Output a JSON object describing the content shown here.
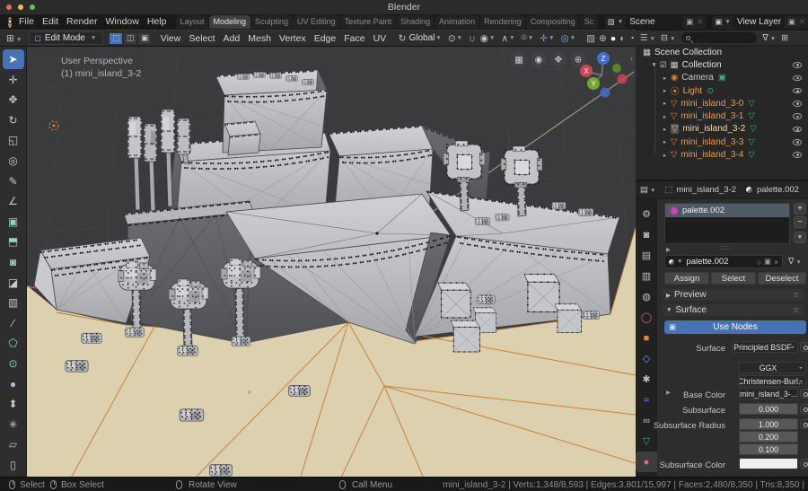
{
  "window": {
    "title": "Blender"
  },
  "menubar": {
    "menus": [
      {
        "name": "menu-file",
        "label": "File"
      },
      {
        "name": "menu-edit",
        "label": "Edit"
      },
      {
        "name": "menu-render",
        "label": "Render"
      },
      {
        "name": "menu-window",
        "label": "Window"
      },
      {
        "name": "menu-help",
        "label": "Help"
      }
    ],
    "workspaces": [
      {
        "name": "workspace-layout",
        "label": "Layout",
        "active": false
      },
      {
        "name": "workspace-modeling",
        "label": "Modeling",
        "active": true
      },
      {
        "name": "workspace-sculpting",
        "label": "Sculpting",
        "active": false
      },
      {
        "name": "workspace-uv-editing",
        "label": "UV Editing",
        "active": false
      },
      {
        "name": "workspace-texture-paint",
        "label": "Texture Paint",
        "active": false
      },
      {
        "name": "workspace-shading",
        "label": "Shading",
        "active": false
      },
      {
        "name": "workspace-animation",
        "label": "Animation",
        "active": false
      },
      {
        "name": "workspace-rendering",
        "label": "Rendering",
        "active": false
      },
      {
        "name": "workspace-compositing",
        "label": "Compositing",
        "active": false
      },
      {
        "name": "workspace-scripting",
        "label": "Sc",
        "active": false
      }
    ],
    "scene_selector": {
      "label": "Scene"
    },
    "view_layer_selector": {
      "label": "View Layer"
    }
  },
  "tool_header": {
    "mode": "Edit Mode",
    "menus": [
      {
        "name": "viewport-menu-view",
        "label": "View"
      },
      {
        "name": "viewport-menu-select",
        "label": "Select"
      },
      {
        "name": "viewport-menu-add",
        "label": "Add"
      },
      {
        "name": "viewport-menu-mesh",
        "label": "Mesh"
      },
      {
        "name": "viewport-menu-vertex",
        "label": "Vertex"
      },
      {
        "name": "viewport-menu-edge",
        "label": "Edge"
      },
      {
        "name": "viewport-menu-face",
        "label": "Face"
      },
      {
        "name": "viewport-menu-uv",
        "label": "UV"
      }
    ],
    "orientation": "Global"
  },
  "toolbar": {
    "tools": [
      {
        "name": "tweak-select-tool",
        "glyph": "➤",
        "color": "#ffffff",
        "active": true
      },
      {
        "name": "cursor-tool",
        "glyph": "✛",
        "color": "#c8c8c8",
        "active": false
      },
      {
        "name": "move-tool",
        "glyph": "✥",
        "color": "#c8c8c8",
        "active": false
      },
      {
        "name": "rotate-tool",
        "glyph": "↻",
        "color": "#c8c8c8",
        "active": false
      },
      {
        "name": "scale-tool",
        "glyph": "◱",
        "color": "#c8c8c8",
        "active": false
      },
      {
        "name": "transform-tool",
        "glyph": "◎",
        "color": "#c8c8c8",
        "active": false
      },
      {
        "name": "annotate-tool",
        "glyph": "✎",
        "color": "#c8c8c8",
        "active": false
      },
      {
        "name": "measure-tool",
        "glyph": "∠",
        "color": "#c8c8c8",
        "active": false
      },
      {
        "name": "add-cube-tool",
        "glyph": "▣",
        "color": "#8fd9b0",
        "active": false
      },
      {
        "name": "extrude-region-tool",
        "glyph": "⬒",
        "color": "#8fd9b0",
        "active": false
      },
      {
        "name": "inset-faces-tool",
        "glyph": "◙",
        "color": "#8fd9b0",
        "active": false
      },
      {
        "name": "bevel-tool",
        "glyph": "◪",
        "color": "#c8c8c8",
        "active": false
      },
      {
        "name": "loop-cut-tool",
        "glyph": "▥",
        "color": "#c8c8c8",
        "active": false
      },
      {
        "name": "knife-tool",
        "glyph": "∕",
        "color": "#c8c8c8",
        "active": false
      },
      {
        "name": "poly-build-tool",
        "glyph": "⬠",
        "color": "#8fd9b0",
        "active": false
      },
      {
        "name": "spin-tool",
        "glyph": "⊙",
        "color": "#8fd9b0",
        "active": false
      },
      {
        "name": "smooth-tool",
        "glyph": "●",
        "color": "#c9a8e0",
        "active": false
      },
      {
        "name": "edge-slide-tool",
        "glyph": "⬍",
        "color": "#c8c8c8",
        "active": false
      },
      {
        "name": "randomize-tool",
        "glyph": "✳",
        "color": "#c8c8c8",
        "active": false
      },
      {
        "name": "shear-tool",
        "glyph": "▱",
        "color": "#c9a8e0",
        "active": false
      },
      {
        "name": "rip-region-tool",
        "glyph": "▯",
        "color": "#c8c8c8",
        "active": false
      }
    ]
  },
  "viewport": {
    "header_line1": "User Perspective",
    "header_line2": "(1) mini_island_3-2",
    "axis_labels": {
      "x": "X",
      "y": "Y",
      "z": "Z"
    }
  },
  "outliner": {
    "scene_collection": "Scene Collection",
    "collection": "Collection",
    "objects": [
      {
        "name": "outliner-item-camera",
        "label": "Camera",
        "glyph": "◉",
        "gc": "#e8822e",
        "data_glyph": "▣",
        "dc": "#35b07a",
        "tc": "#c8c8c8",
        "boxed": false
      },
      {
        "name": "outliner-item-light",
        "label": "Light",
        "glyph": "⦿",
        "gc": "#e8822e",
        "data_glyph": "⊙",
        "dc": "#35b07a",
        "tc": "#eb9b4d",
        "boxed": false
      },
      {
        "name": "outliner-item-mini-island-3-0",
        "label": "mini_island_3-0",
        "glyph": "▽",
        "gc": "#e8822e",
        "data_glyph": "▽",
        "dc": "#35b07a",
        "tc": "#eb9b4d",
        "boxed": false
      },
      {
        "name": "outliner-item-mini-island-3-1",
        "label": "mini_island_3-1",
        "glyph": "▽",
        "gc": "#e8822e",
        "data_glyph": "▽",
        "dc": "#35b07a",
        "tc": "#eb9b4d",
        "boxed": false
      },
      {
        "name": "outliner-item-mini-island-3-2",
        "label": "mini_island_3-2",
        "glyph": "▽",
        "gc": "#f0b080",
        "data_glyph": "▽",
        "dc": "#35b07a",
        "tc": "#ffd9ae",
        "boxed": true
      },
      {
        "name": "outliner-item-mini-island-3-3",
        "label": "mini_island_3-3",
        "glyph": "▽",
        "gc": "#e8822e",
        "data_glyph": "▽",
        "dc": "#35b07a",
        "tc": "#eb9b4d",
        "boxed": false
      },
      {
        "name": "outliner-item-mini-island-3-4",
        "label": "mini_island_3-4",
        "glyph": "▽",
        "gc": "#e8822e",
        "data_glyph": "▽",
        "dc": "#35b07a",
        "tc": "#eb9b4d",
        "boxed": false
      }
    ]
  },
  "properties": {
    "breadcrumb": {
      "object": "mini_island_3-2",
      "material": "palette.002"
    },
    "tabs": [
      {
        "name": "properties-tab-tool",
        "glyph": "⚙",
        "color": "#c0c0c0",
        "active": false
      },
      {
        "name": "properties-tab-render",
        "glyph": "◙",
        "color": "#c0c0c0",
        "active": false
      },
      {
        "name": "properties-tab-output",
        "glyph": "▤",
        "color": "#c0c0c0",
        "active": false
      },
      {
        "name": "properties-tab-view-layer",
        "glyph": "▥",
        "color": "#c0c0c0",
        "active": false
      },
      {
        "name": "properties-tab-scene",
        "glyph": "◍",
        "color": "#c0c0c0",
        "active": false
      },
      {
        "name": "properties-tab-world",
        "glyph": "◯",
        "color": "#d86a6a",
        "active": false
      },
      {
        "name": "properties-tab-object",
        "glyph": "■",
        "color": "#e8822e",
        "active": false
      },
      {
        "name": "properties-tab-modifiers",
        "glyph": "◇",
        "color": "#6aa1e8",
        "active": false
      },
      {
        "name": "properties-tab-particles",
        "glyph": "✱",
        "color": "#c0c0c0",
        "active": false
      },
      {
        "name": "properties-tab-physics",
        "glyph": "≈",
        "color": "#6aa1e8",
        "active": false
      },
      {
        "name": "properties-tab-constraints",
        "glyph": "∞",
        "color": "#c0c0c0",
        "active": false
      },
      {
        "name": "properties-tab-object-data",
        "glyph": "▽",
        "color": "#35b07a",
        "active": false
      },
      {
        "name": "properties-tab-material",
        "glyph": "●",
        "color": "#e86a9c",
        "active": true
      }
    ],
    "slot": {
      "name": "palette.002",
      "dot_color": "#e13ab5"
    },
    "material_field": {
      "name": "palette.002"
    },
    "buttons": {
      "assign": "Assign",
      "select": "Select",
      "deselect": "Deselect"
    },
    "panels": {
      "preview": "Preview",
      "surface": "Surface"
    },
    "use_nodes": "Use Nodes",
    "fields": {
      "surface_label": "Surface",
      "surface_value": "Principled BSDF",
      "distribution": "GGX",
      "subsurface_method": "Christensen-Burl..",
      "base_color_label": "Base Color",
      "base_color_value": "mini_island_3-...",
      "subsurface_label": "Subsurface",
      "subsurface_value": "0.000",
      "radius_label": "Subsurface Radius",
      "radius_values": [
        "1.000",
        "0.200",
        "0.100"
      ],
      "color_label": "Subsurface Color"
    }
  },
  "statusbar": {
    "hints": [
      {
        "name": "hint-select",
        "label": "Select"
      },
      {
        "name": "hint-box-select",
        "label": "Box Select"
      },
      {
        "name": "hint-rotate-view",
        "label": "Rotate View"
      },
      {
        "name": "hint-call-menu",
        "label": "Call Menu"
      }
    ],
    "stats": "mini_island_3-2 | Verts:1,348/8,593 | Edges:3,801/15,997 | Faces:2,480/8,350 | Tris:8,350 |"
  },
  "colors": {
    "accent_blue": "#4772b3",
    "selection_orange": "#e8822e",
    "data_green": "#35b07a",
    "ground_tan": "#dcd0af",
    "ground_edge_orange": "#c8813c",
    "material_pink": "#e13ab5"
  }
}
